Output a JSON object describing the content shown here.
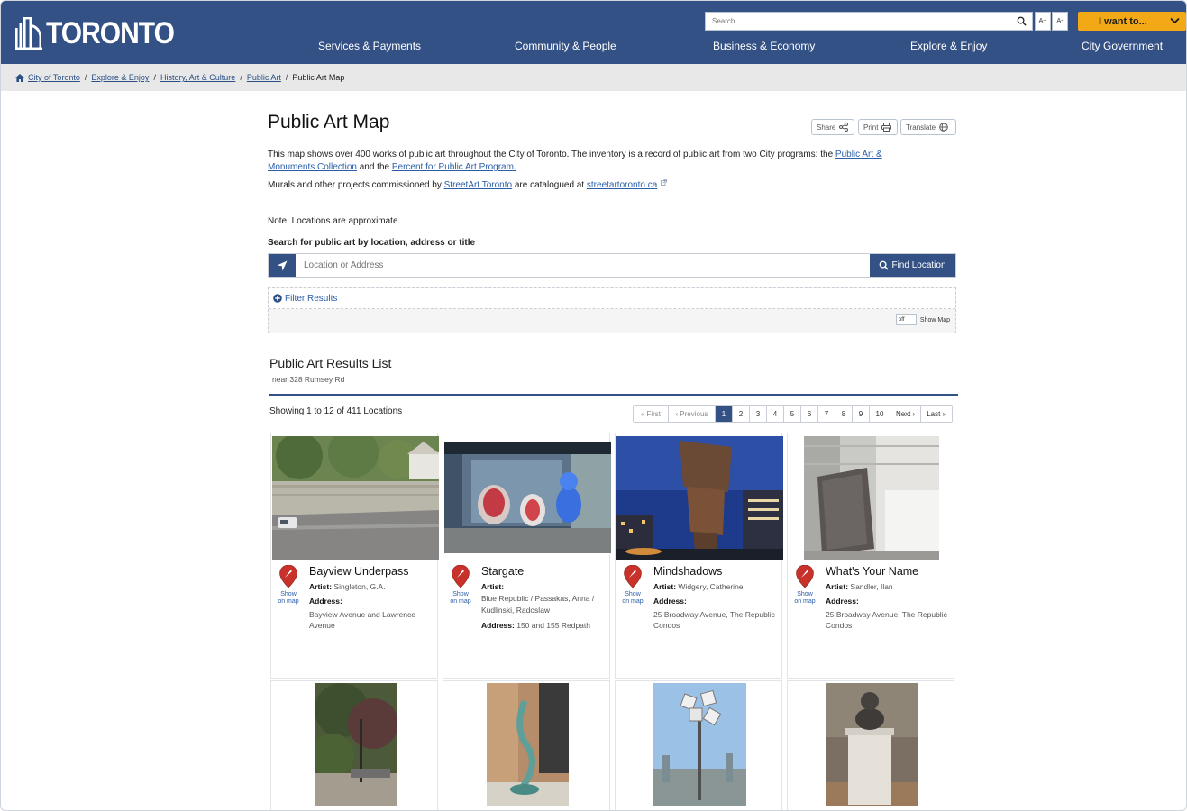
{
  "header": {
    "logo_text": "TORONTO",
    "search_placeholder": "Search",
    "font_increase": "A+",
    "font_decrease": "A-",
    "i_want_to": "I want to...",
    "nav": [
      "Services & Payments",
      "Community & People",
      "Business & Economy",
      "Explore & Enjoy",
      "City Government"
    ]
  },
  "breadcrumb": {
    "items": [
      "City of Toronto",
      "Explore & Enjoy",
      "History, Art & Culture",
      "Public Art"
    ],
    "current": "Public Art Map"
  },
  "page": {
    "title": "Public Art Map",
    "share": "Share",
    "print": "Print",
    "translate": "Translate",
    "intro_text": "This map shows over 400 works of public art throughout the City of Toronto. The inventory is a record of public art from two City programs: the ",
    "intro_link1": "Public Art & Monuments Collection",
    "intro_and": " and the ",
    "intro_link2": "Percent for Public Art Program.",
    "murals_text": "Murals and other projects commissioned by ",
    "murals_link": "StreetArt Toronto",
    "murals_mid": " are catalogued at ",
    "murals_link2": "streetartoronto.ca",
    "note": "Note: Locations are approximate.",
    "search_label": "Search for public art by location, address or title",
    "location_placeholder": "Location or Address",
    "find_location": "Find Location",
    "filter_results": "Filter Results",
    "toggle_state": "off",
    "show_map": "Show Map"
  },
  "results": {
    "title": "Public Art Results List",
    "near": "near 328 Rumsey Rd",
    "showing": "Showing 1 to 12 of 411 Locations",
    "pager": {
      "first": "First",
      "previous": "Previous",
      "pages": [
        "1",
        "2",
        "3",
        "4",
        "5",
        "6",
        "7",
        "8",
        "9",
        "10"
      ],
      "next": "Next",
      "last": "Last",
      "current": "1"
    },
    "show_on_map": [
      "Show",
      "on map"
    ],
    "artist_label": "Artist:",
    "address_label": "Address:",
    "cards": [
      {
        "name": "Bayview Underpass",
        "artist": "Singleton, G.A.",
        "address": "Bayview Avenue and Lawrence Avenue"
      },
      {
        "name": "Stargate",
        "artist": "Blue Republic / Passakas, Anna / Kudlinski, Radoslaw",
        "address": "150 and 155 Redpath"
      },
      {
        "name": "Mindshadows",
        "artist": "Widgery, Catherine",
        "address": "25 Broadway Avenue, The Republic Condos"
      },
      {
        "name": "What's Your Name",
        "artist": "Sandler, Ilan",
        "address": "25 Broadway Avenue, The Republic Condos"
      }
    ]
  },
  "colors": {
    "header_blue": "#335185",
    "accent_orange": "#f3a916",
    "link_blue": "#2a5ea8",
    "marker_red": "#c8322b"
  }
}
